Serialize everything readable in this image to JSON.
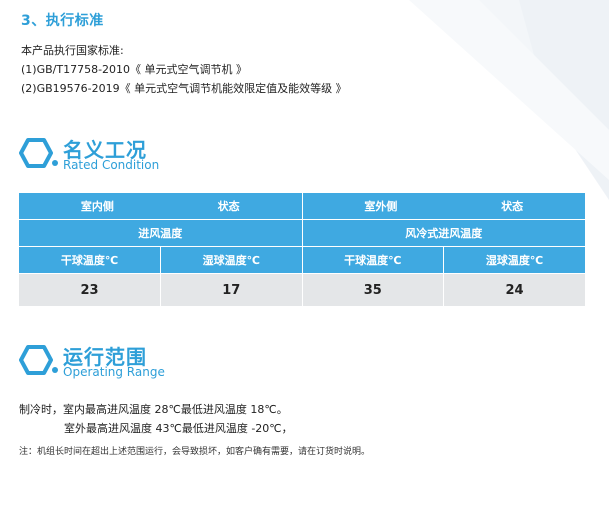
{
  "colors": {
    "accent": "#2e9fd8",
    "table_header": "#3fa9e1",
    "table_value_bg": "#e4e6e8"
  },
  "standards": {
    "heading": "3、执行标准",
    "intro": "本产品执行国家标准:",
    "items": [
      "(1)GB/T17758-2010《 单元式空气调节机 》",
      "(2)GB19576-2019《 单元式空气调节机能效限定值及能效等级 》"
    ]
  },
  "rated_condition": {
    "title_zh": "名义工况",
    "title_en": "Rated Condition",
    "icon": "hexagon-icon",
    "table": {
      "row1": [
        {
          "left": "室内侧",
          "right": "状态"
        },
        {
          "left": "室外侧",
          "right": "状态"
        }
      ],
      "row2": [
        "进风温度",
        "风冷式进风温度"
      ],
      "row3": [
        "干球温度℃",
        "湿球温度℃",
        "干球温度℃",
        "湿球温度℃"
      ],
      "values": [
        "23",
        "17",
        "35",
        "24"
      ]
    }
  },
  "operating_range": {
    "title_zh": "运行范围",
    "title_en": "Operating Range",
    "icon": "hexagon-icon",
    "line1": "制冷时，室内最高进风温度 28℃最低进风温度 18℃。",
    "line2": "室外最高进风温度 43℃最低进风温度 -20℃，",
    "note": "注：机组长时间在超出上述范围运行，会导致损坏，如客户确有需要，请在订货时说明。"
  }
}
